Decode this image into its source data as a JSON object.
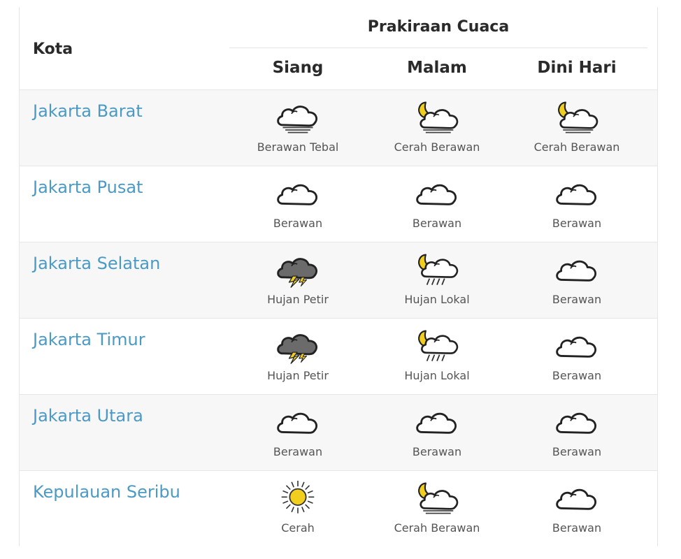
{
  "header": {
    "city_col": "Kota",
    "forecast_title": "Prakiraan Cuaca",
    "periods": [
      "Siang",
      "Malam",
      "Dini Hari"
    ]
  },
  "colors": {
    "link": "#4b9ac6",
    "sun": "#f2cf1e",
    "moon": "#f2cf1e",
    "storm_cloud": "#6b6b6b",
    "lightning": "#f2cf1e"
  },
  "rows": [
    {
      "city": "Jakarta Barat",
      "forecast": [
        {
          "label": "Berawan Tebal",
          "icon": "thick-cloud-icon"
        },
        {
          "label": "Cerah Berawan",
          "icon": "moon-cloud-icon"
        },
        {
          "label": "Cerah Berawan",
          "icon": "moon-cloud-icon"
        }
      ]
    },
    {
      "city": "Jakarta Pusat",
      "forecast": [
        {
          "label": "Berawan",
          "icon": "cloud-icon"
        },
        {
          "label": "Berawan",
          "icon": "cloud-icon"
        },
        {
          "label": "Berawan",
          "icon": "cloud-icon"
        }
      ]
    },
    {
      "city": "Jakarta Selatan",
      "forecast": [
        {
          "label": "Hujan Petir",
          "icon": "thunderstorm-icon"
        },
        {
          "label": "Hujan Lokal",
          "icon": "moon-rain-icon"
        },
        {
          "label": "Berawan",
          "icon": "cloud-icon"
        }
      ]
    },
    {
      "city": "Jakarta Timur",
      "forecast": [
        {
          "label": "Hujan Petir",
          "icon": "thunderstorm-icon"
        },
        {
          "label": "Hujan Lokal",
          "icon": "moon-rain-icon"
        },
        {
          "label": "Berawan",
          "icon": "cloud-icon"
        }
      ]
    },
    {
      "city": "Jakarta Utara",
      "forecast": [
        {
          "label": "Berawan",
          "icon": "cloud-icon"
        },
        {
          "label": "Berawan",
          "icon": "cloud-icon"
        },
        {
          "label": "Berawan",
          "icon": "cloud-icon"
        }
      ]
    },
    {
      "city": "Kepulauan Seribu",
      "forecast": [
        {
          "label": "Cerah",
          "icon": "sun-icon"
        },
        {
          "label": "Cerah Berawan",
          "icon": "moon-cloud-icon"
        },
        {
          "label": "Berawan",
          "icon": "cloud-icon"
        }
      ]
    }
  ]
}
